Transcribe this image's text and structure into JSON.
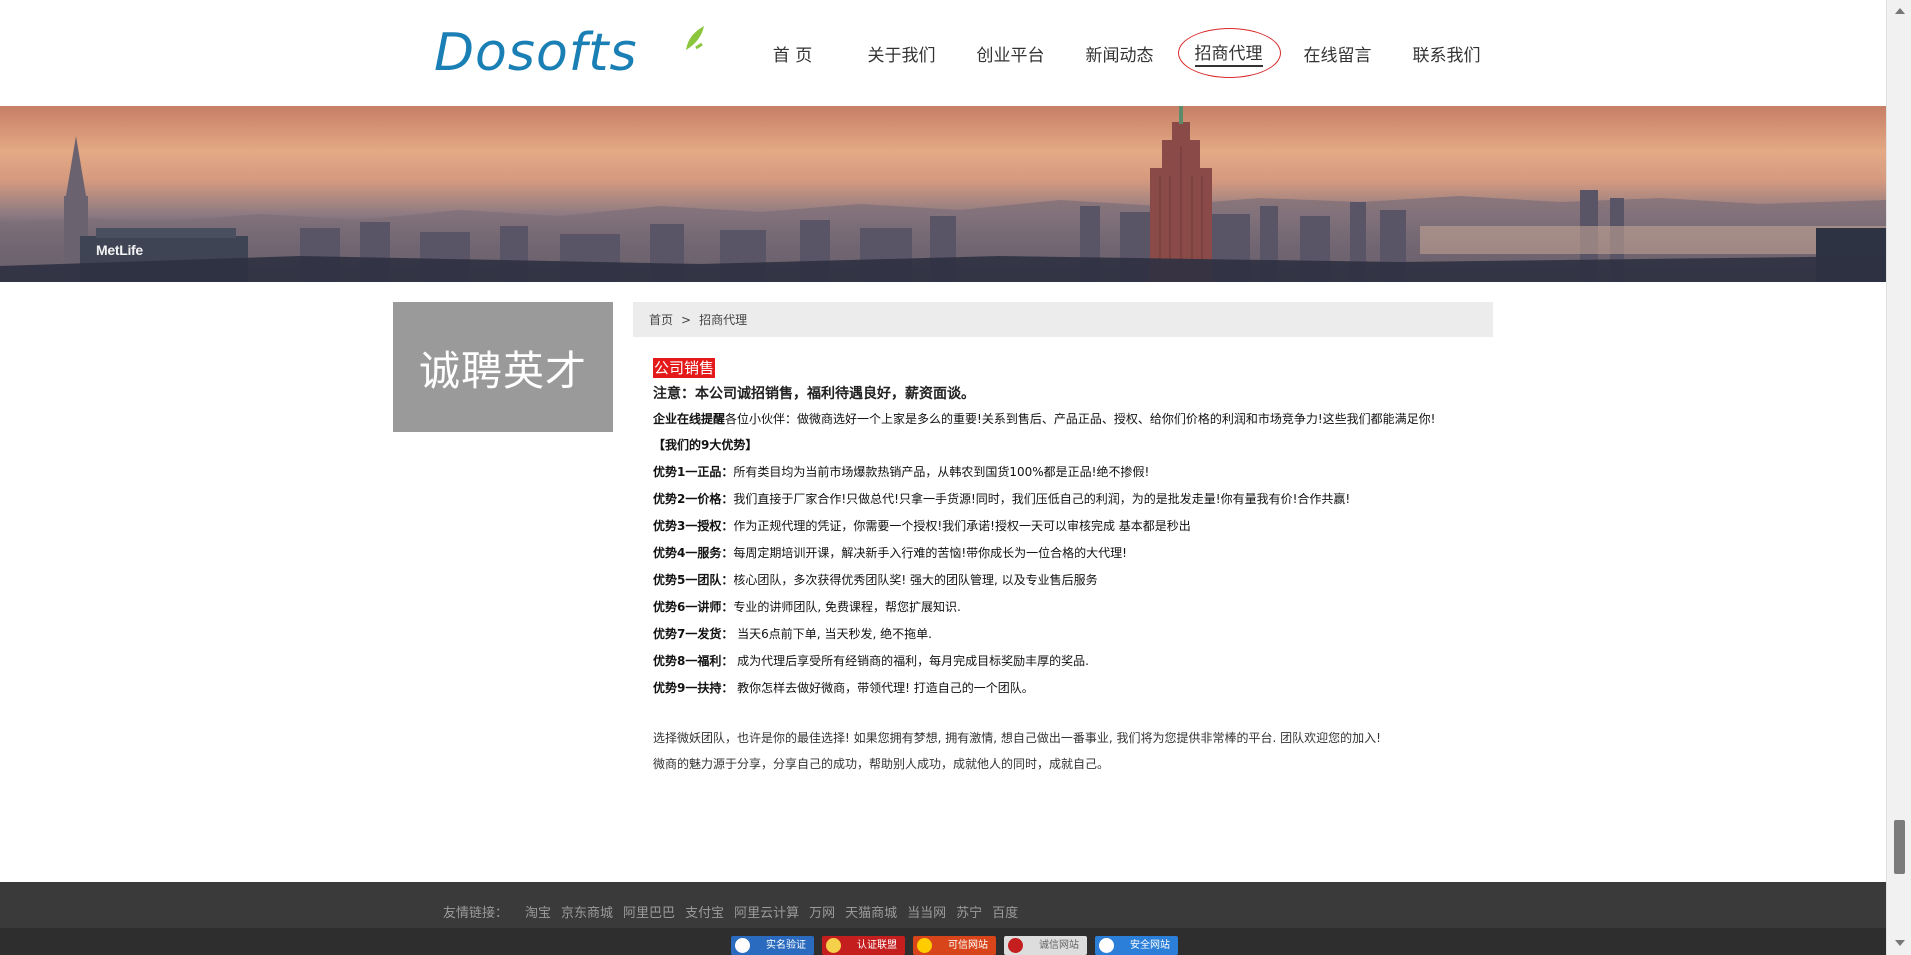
{
  "brand": {
    "logo_text": "Dosofts",
    "logo_color": "#1a7fb4",
    "leaf_color": "#8cc63f"
  },
  "nav": [
    {
      "label": "首 页",
      "active": false
    },
    {
      "label": "关于我们",
      "active": false
    },
    {
      "label": "创业平台",
      "active": false
    },
    {
      "label": "新闻动态",
      "active": false
    },
    {
      "label": "招商代理",
      "active": true
    },
    {
      "label": "在线留言",
      "active": false
    },
    {
      "label": "联系我们",
      "active": false
    }
  ],
  "banner": {
    "building_sign": "MetLife"
  },
  "sidebar": {
    "title": "诚聘英才"
  },
  "breadcrumb": {
    "home": "首页",
    "separator": ">",
    "current": "招商代理"
  },
  "content": {
    "tag": "公司销售",
    "notice": "注意：本公司诚招销售，福利待遇良好，薪资面谈。",
    "intro": {
      "label": "企业在线提醒",
      "text": "各位小伙伴：做微商选好一个上家是多么的重要!关系到售后、产品正品、授权、给你们价格的利润和市场竞争力!这些我们都能满足你!"
    },
    "heading": "【我们的9大优势】",
    "advantages": [
      {
        "label": "优势1一正品：",
        "text": "所有类目均为当前市场爆款热销产品，从韩农到国货100%都是正品!绝不掺假!"
      },
      {
        "label": "优势2一价格：",
        "text": "我们直接于厂家合作!只做总代!只拿一手货源!同时，我们压低自己的利润，为的是批发走量!你有量我有价!合作共赢!"
      },
      {
        "label": "优势3一授权：",
        "text": "作为正规代理的凭证，你需要一个授权!我们承诺!授权一天可以审核完成 基本都是秒出"
      },
      {
        "label": "优势4一服务：",
        "text": "每周定期培训开课，解决新手入行难的苦恼!带你成长为一位合格的大代理!"
      },
      {
        "label": "优势5一团队：",
        "text": "核心团队，多次获得优秀团队奖! 强大的团队管理, 以及专业售后服务"
      },
      {
        "label": "优势6一讲师：",
        "text": "专业的讲师团队, 免费课程，帮您扩展知识."
      },
      {
        "label": "优势7一发货：",
        "text": " 当天6点前下单, 当天秒发, 绝不拖单."
      },
      {
        "label": "优势8一福利：",
        "text": " 成为代理后享受所有经销商的福利，每月完成目标奖励丰厚的奖品."
      },
      {
        "label": "优势9一扶持：",
        "text": " 教你怎样去做好微商，带领代理! 打造自己的一个团队。"
      }
    ],
    "outro": [
      "选择微妖团队，也许是你的最佳选择! 如果您拥有梦想, 拥有激情, 想自己做出一番事业, 我们将为您提供非常棒的平台. 团队欢迎您的加入!",
      "微商的魅力源于分享，分享自己的成功，帮助别人成功，成就他人的同时，成就自己。"
    ]
  },
  "footer": {
    "label": "友情链接：",
    "links": [
      "淘宝",
      "京东商城",
      "阿里巴巴",
      "支付宝",
      "阿里云计算",
      "万网",
      "天猫商城",
      "当当网",
      "苏宁",
      "百度"
    ],
    "badges": [
      {
        "text": "实名验证",
        "color": "#2a6bbf",
        "dot": "#ffffff"
      },
      {
        "text": "认证联盟",
        "color": "#c41e1e",
        "dot": "#f5d04a"
      },
      {
        "text": "可信网站",
        "color": "#d9451a",
        "dot": "#ffcc00"
      },
      {
        "text": "诚信网站",
        "color": "#dddddd",
        "dot": "#c41e1e"
      },
      {
        "text": "安全网站",
        "color": "#2b7fd8",
        "dot": "#ffffff"
      }
    ]
  },
  "colors": {
    "active_nav_ring": "#d92b2b",
    "tag_bg": "#e41a1a",
    "sidebar_bg": "#9a9a9a",
    "footer_bg": "#3a3a3a"
  }
}
